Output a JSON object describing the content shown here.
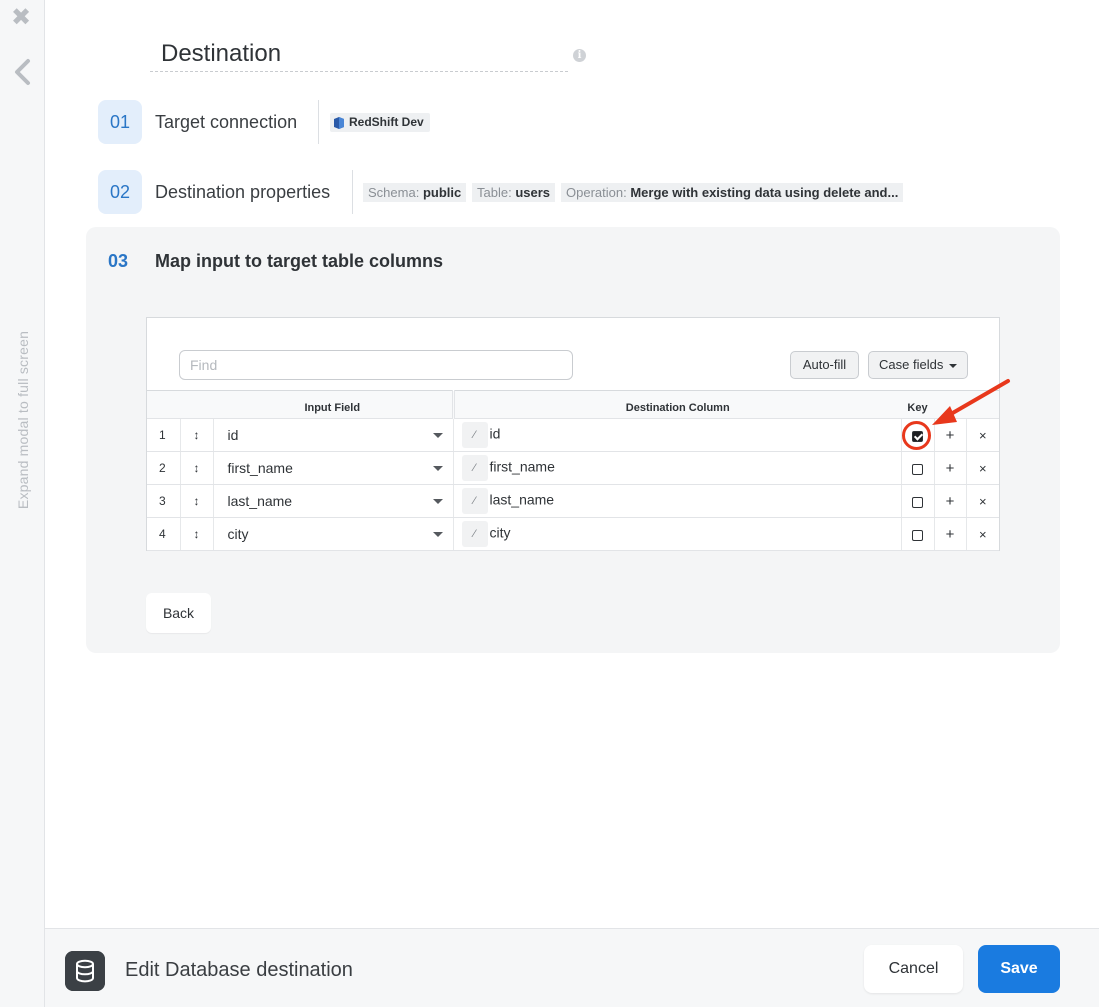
{
  "rail": {
    "close_glyph": "✖",
    "back_icon": "chevron-left-icon",
    "expand_label": "Expand modal to full screen"
  },
  "header": {
    "title": "Destination",
    "info_glyph": "i"
  },
  "steps": [
    {
      "number": "01",
      "label": "Target connection"
    },
    {
      "number": "02",
      "label": "Destination properties"
    }
  ],
  "connection": {
    "name": "RedShift Dev",
    "icon": "redshift-icon"
  },
  "properties": [
    {
      "key": "Schema:",
      "value": "public"
    },
    {
      "key": "Table:",
      "value": "users"
    },
    {
      "key": "Operation:",
      "value": "Merge with existing data using delete and..."
    }
  ],
  "mapping": {
    "number": "03",
    "title": "Map input to target table columns",
    "find_placeholder": "Find",
    "autofill_label": "Auto-fill",
    "case_fields_label": "Case fields",
    "columns": {
      "input": "Input Field",
      "dest": "Destination Column",
      "key": "Key"
    },
    "rows": [
      {
        "n": "1",
        "input": "id",
        "dest": "id",
        "key": true
      },
      {
        "n": "2",
        "input": "first_name",
        "dest": "first_name",
        "key": false
      },
      {
        "n": "3",
        "input": "last_name",
        "dest": "last_name",
        "key": false
      },
      {
        "n": "4",
        "input": "city",
        "dest": "city",
        "key": false
      }
    ],
    "drag_glyph": "↕",
    "wand_glyph": "⁄",
    "plus_glyph": "+",
    "remove_glyph": "×",
    "back_label": "Back"
  },
  "footer": {
    "icon": "database-icon",
    "title": "Edit Database destination",
    "cancel_label": "Cancel",
    "save_label": "Save"
  },
  "colors": {
    "accent": "#1a7be0",
    "step_bg": "#e3eefb",
    "annotation": "#e8381c"
  }
}
